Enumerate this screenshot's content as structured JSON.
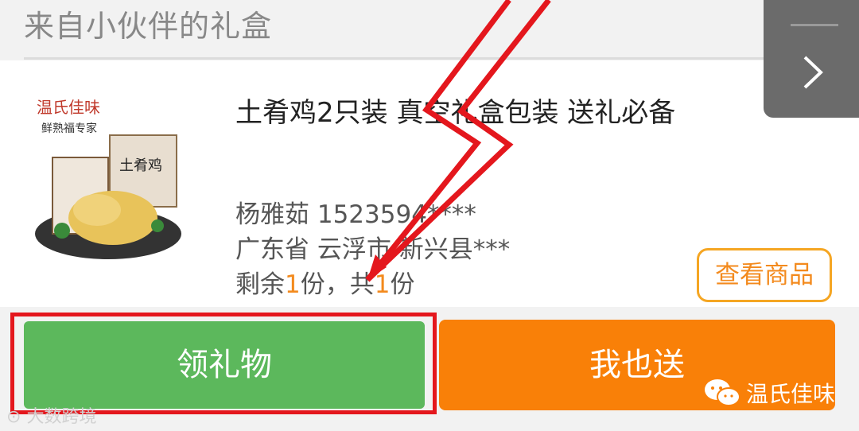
{
  "header": {
    "title": "来自小伙伴的礼盒"
  },
  "product": {
    "title": "土肴鸡2只装 真空礼盒包装 送礼必备",
    "image_brand": "温氏佳味",
    "image_slogan": "鲜熟福专家",
    "image_product": "土肴鸡"
  },
  "recipient": {
    "name_phone": "杨雅茹 1523594****",
    "address": "广东省 云浮市 新兴县***",
    "remain_prefix": "剩余",
    "remain_count": "1",
    "remain_mid": "份，共",
    "total_count": "1",
    "remain_suffix": "份"
  },
  "buttons": {
    "view_goods": "查看商品",
    "receive_gift": "领礼物",
    "send_too": "我也送"
  },
  "watermarks": {
    "left": "大数跨境",
    "right": "温氏佳味"
  },
  "colors": {
    "green": "#5cb85c",
    "orange": "#f98008",
    "highlight": "#f38a1d",
    "annotation_red": "#e4171d"
  }
}
